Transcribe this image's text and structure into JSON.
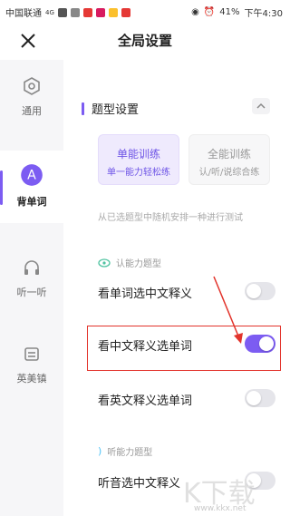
{
  "status_bar": {
    "carrier": "中国联通",
    "network": "4G",
    "battery": "41%",
    "time": "下午4:30"
  },
  "header": {
    "title": "全局设置"
  },
  "sidebar": {
    "items": [
      {
        "label": "通用"
      },
      {
        "label": "背单词",
        "active": true
      },
      {
        "label": "听一听"
      },
      {
        "label": "英美镇"
      }
    ]
  },
  "main": {
    "section_title": "题型设置",
    "modes": [
      {
        "title": "单能训练",
        "subtitle": "单一能力轻松练",
        "selected": true
      },
      {
        "title": "全能训练",
        "subtitle": "认/听/说综合练",
        "selected": false
      }
    ],
    "description": "从已选题型中随机安排一种进行测试",
    "group_recognition": "认能力题型",
    "group_listening": "听能力题型",
    "options": [
      {
        "label": "看单词选中文释义",
        "enabled": false
      },
      {
        "label": "看中文释义选单词",
        "enabled": true
      },
      {
        "label": "看英文释义选单词",
        "enabled": false
      },
      {
        "label": "听音选中文释义",
        "enabled": false
      }
    ]
  },
  "watermark": {
    "logo_text": "K下载",
    "url": "www.kkx.net"
  },
  "colors": {
    "accent": "#7c5cf2",
    "highlight": "#e2332b"
  }
}
